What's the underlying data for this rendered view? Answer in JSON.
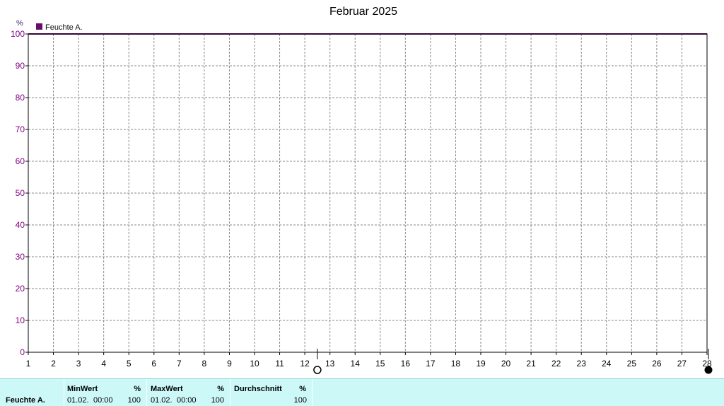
{
  "chart_data": {
    "type": "line",
    "title": "Februar 2025",
    "y_unit": "%",
    "ylim": [
      0,
      100
    ],
    "y_ticks": [
      0,
      10,
      20,
      30,
      40,
      50,
      60,
      70,
      80,
      90,
      100
    ],
    "x_ticks": [
      "1",
      "2",
      "3",
      "4",
      "5",
      "6",
      "7",
      "8",
      "9",
      "10",
      "11",
      "12",
      "13",
      "14",
      "15",
      "16",
      "17",
      "18",
      "19",
      "20",
      "21",
      "22",
      "23",
      "24",
      "25",
      "26",
      "27",
      "28"
    ],
    "xlim": [
      1,
      28
    ],
    "grid": true,
    "legend_position": "top-left",
    "series": [
      {
        "name": "Feuchte A.",
        "color": "#6a0d6a",
        "x": [
          1,
          28
        ],
        "y": [
          100,
          100
        ]
      }
    ],
    "markers": {
      "open_circle_day": 12.5,
      "filled_circle_day": 28
    }
  },
  "colors": {
    "axis_label": "#800080",
    "x_label": "#000000",
    "grid": "#8a8a8a",
    "stats_background": "#cdf8f8"
  },
  "stats": {
    "series_label": "Feuchte A.",
    "min": {
      "header": "MinWert",
      "unit": "%",
      "date": "01.02.",
      "time": "00:00",
      "value": "100"
    },
    "max": {
      "header": "MaxWert",
      "unit": "%",
      "date": "01.02.",
      "time": "00:00",
      "value": "100"
    },
    "avg": {
      "header": "Durchschnitt",
      "unit": "%",
      "value": "100"
    }
  }
}
